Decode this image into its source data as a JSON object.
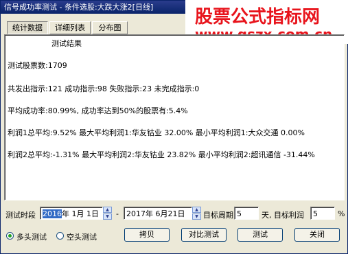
{
  "window": {
    "title": "信号成功率测试 - 条件选股:大跌大涨2[日线]"
  },
  "watermark": {
    "text_cn": "股票公式指标网",
    "text_url": "www.gszx.com.cn"
  },
  "tabs": [
    {
      "label": "统计数据",
      "active": true
    },
    {
      "label": "详细列表",
      "active": false
    },
    {
      "label": "分布图",
      "active": false
    }
  ],
  "results": {
    "heading": "测试结果",
    "lines": [
      "测试股票数:1709",
      "共发出指示:121 成功指示:98 失败指示:23 未完成指示:0",
      "平均成功率:80.99%, 成功率达到50%的股票有:5.4%",
      "利润1总平均:9.52% 最大平均利润1:华友钴业 32.00% 最小平均利润1:大众交通 0.00%",
      "利润2总平均:-1.31% 最大平均利润2:华友钴业 23.82% 最小平均利润2:超讯通信 -31.44%"
    ]
  },
  "controls": {
    "period_label": "测试时段",
    "start_date": {
      "year": "2016",
      "rest": "年  1月  1日"
    },
    "dash": "-",
    "end_date": "2017年  6月21日",
    "target_period_label": "目标周期",
    "target_period_value": "5",
    "day_unit": "天, 目标利润",
    "target_profit_value": "5",
    "percent": "%"
  },
  "radios": [
    {
      "label": "多头测试",
      "checked": true
    },
    {
      "label": "空头测试",
      "checked": false
    }
  ],
  "buttons": {
    "copy": "拷贝",
    "compare": "对比测试",
    "test": "测试",
    "close": "关闭"
  },
  "colors": {
    "titlebar": "#0a246a",
    "watermark": "#e8141c",
    "highlight": "#316ac5"
  }
}
